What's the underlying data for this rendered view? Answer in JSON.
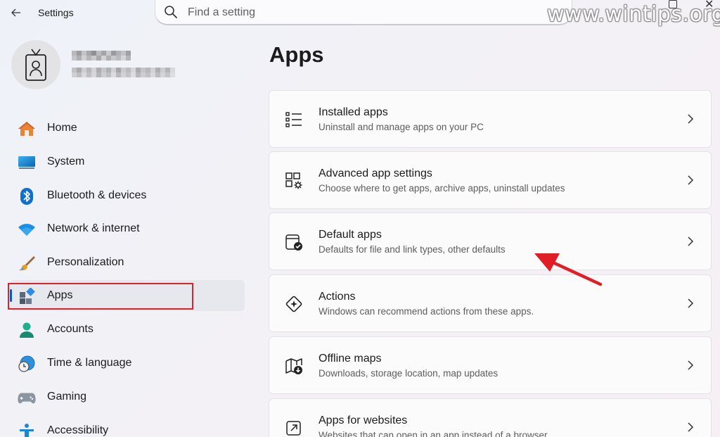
{
  "window": {
    "title": "Settings",
    "watermark": "www.wintips.org"
  },
  "search": {
    "placeholder": "Find a setting"
  },
  "sidebar": {
    "items": [
      {
        "label": "Home",
        "icon": "home-icon"
      },
      {
        "label": "System",
        "icon": "system-icon"
      },
      {
        "label": "Bluetooth & devices",
        "icon": "bluetooth-icon"
      },
      {
        "label": "Network & internet",
        "icon": "wifi-icon"
      },
      {
        "label": "Personalization",
        "icon": "brush-icon"
      },
      {
        "label": "Apps",
        "icon": "apps-icon",
        "active": true
      },
      {
        "label": "Accounts",
        "icon": "account-icon"
      },
      {
        "label": "Time & language",
        "icon": "clock-globe-icon"
      },
      {
        "label": "Gaming",
        "icon": "gamepad-icon"
      },
      {
        "label": "Accessibility",
        "icon": "accessibility-icon"
      }
    ]
  },
  "main": {
    "title": "Apps",
    "cards": [
      {
        "title": "Installed apps",
        "subtitle": "Uninstall and manage apps on your PC",
        "icon": "list-icon"
      },
      {
        "title": "Advanced app settings",
        "subtitle": "Choose where to get apps, archive apps, uninstall updates",
        "icon": "app-settings-icon"
      },
      {
        "title": "Default apps",
        "subtitle": "Defaults for file and link types, other defaults",
        "icon": "default-apps-icon"
      },
      {
        "title": "Actions",
        "subtitle": "Windows can recommend actions from these apps.",
        "icon": "actions-icon"
      },
      {
        "title": "Offline maps",
        "subtitle": "Downloads, storage location, map updates",
        "icon": "map-download-icon"
      },
      {
        "title": "Apps for websites",
        "subtitle": "Websites that can open in an app instead of a browser",
        "icon": "open-in-app-icon"
      }
    ]
  },
  "colors": {
    "accent": "#005fb8",
    "highlight": "#d9232d",
    "arrow": "#e01e26"
  }
}
